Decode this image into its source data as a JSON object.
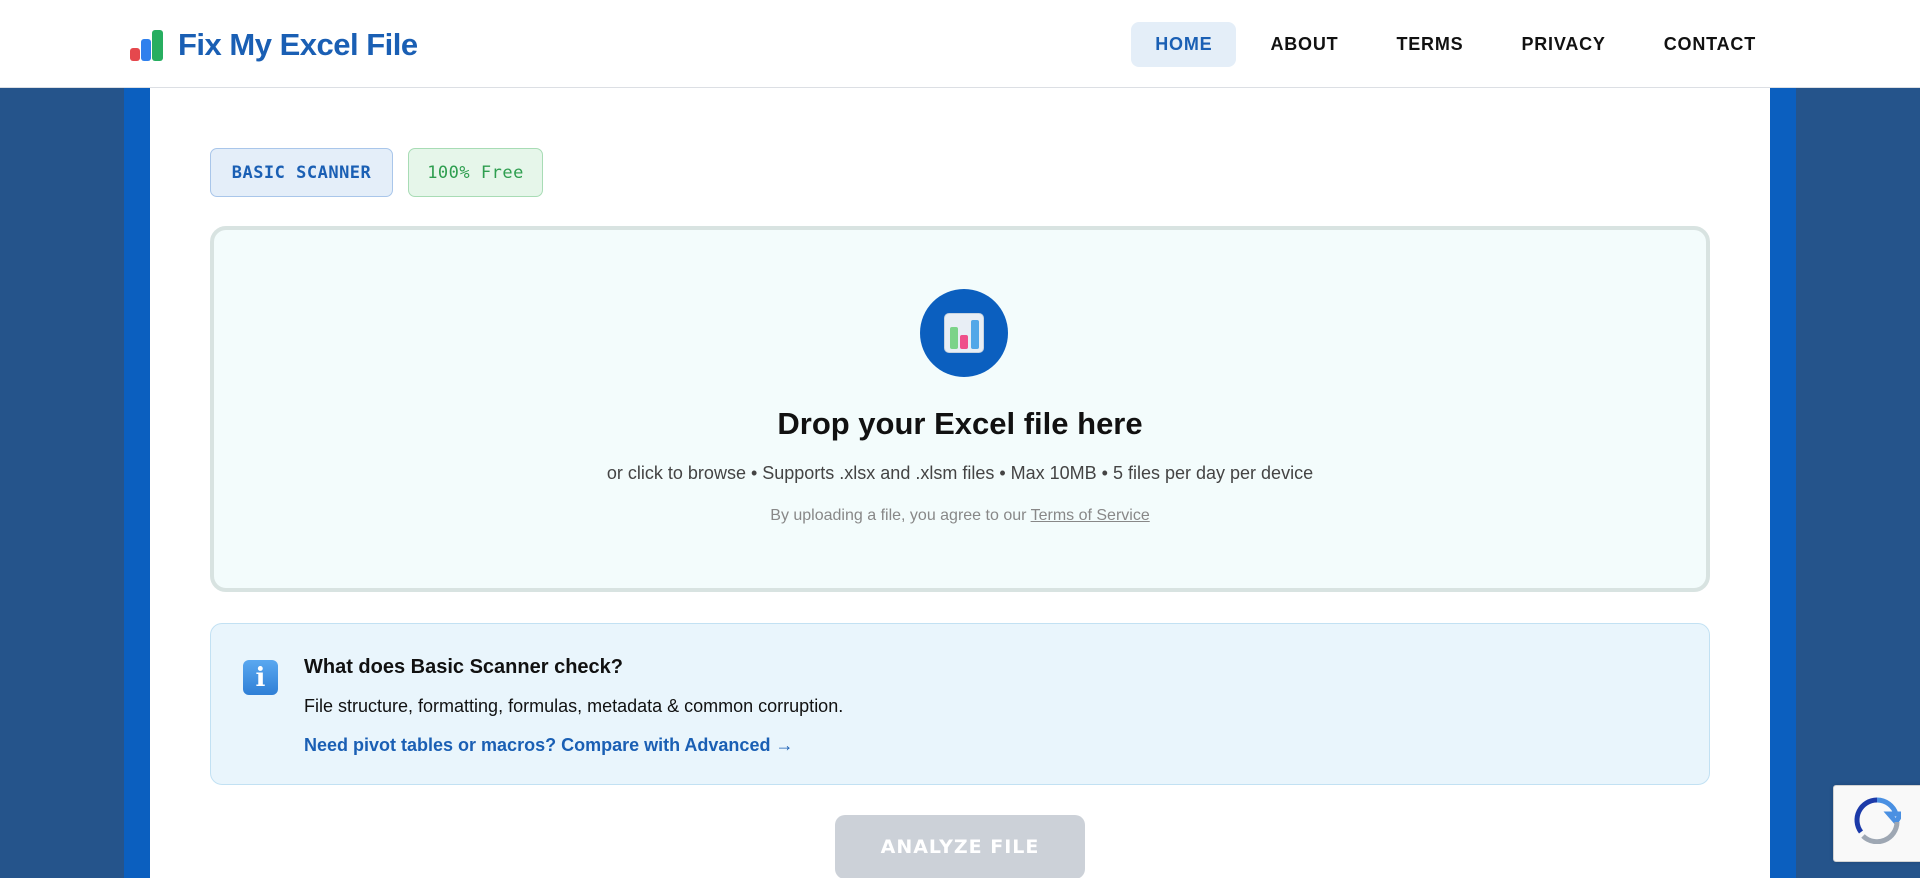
{
  "header": {
    "logo_text": "Fix My Excel File",
    "nav": [
      {
        "label": "HOME",
        "active": true
      },
      {
        "label": "ABOUT",
        "active": false
      },
      {
        "label": "TERMS",
        "active": false
      },
      {
        "label": "PRIVACY",
        "active": false
      },
      {
        "label": "CONTACT",
        "active": false
      }
    ]
  },
  "badges": {
    "basic": "BASIC SCANNER",
    "free": "100% Free"
  },
  "dropzone": {
    "icon": "bar-chart-icon",
    "title": "Drop your Excel file here",
    "subtitle": "or click to browse • Supports .xlsx and .xlsm files • Max 10MB • 5 files per day per device",
    "terms_prefix": "By uploading a file, you agree to our ",
    "terms_link": "Terms of Service"
  },
  "info": {
    "icon": "info-icon",
    "title": "What does Basic Scanner check?",
    "text": "File structure, formatting, formulas, metadata & common corruption.",
    "link": "Need pivot tables or macros? Compare with Advanced →"
  },
  "actions": {
    "analyze_label": "ANALYZE FILE"
  },
  "colors": {
    "brand": "#1a5fb4",
    "page_bg": "#25548b",
    "frame": "#0b5fbf",
    "button_disabled": "#ccd1d8"
  }
}
